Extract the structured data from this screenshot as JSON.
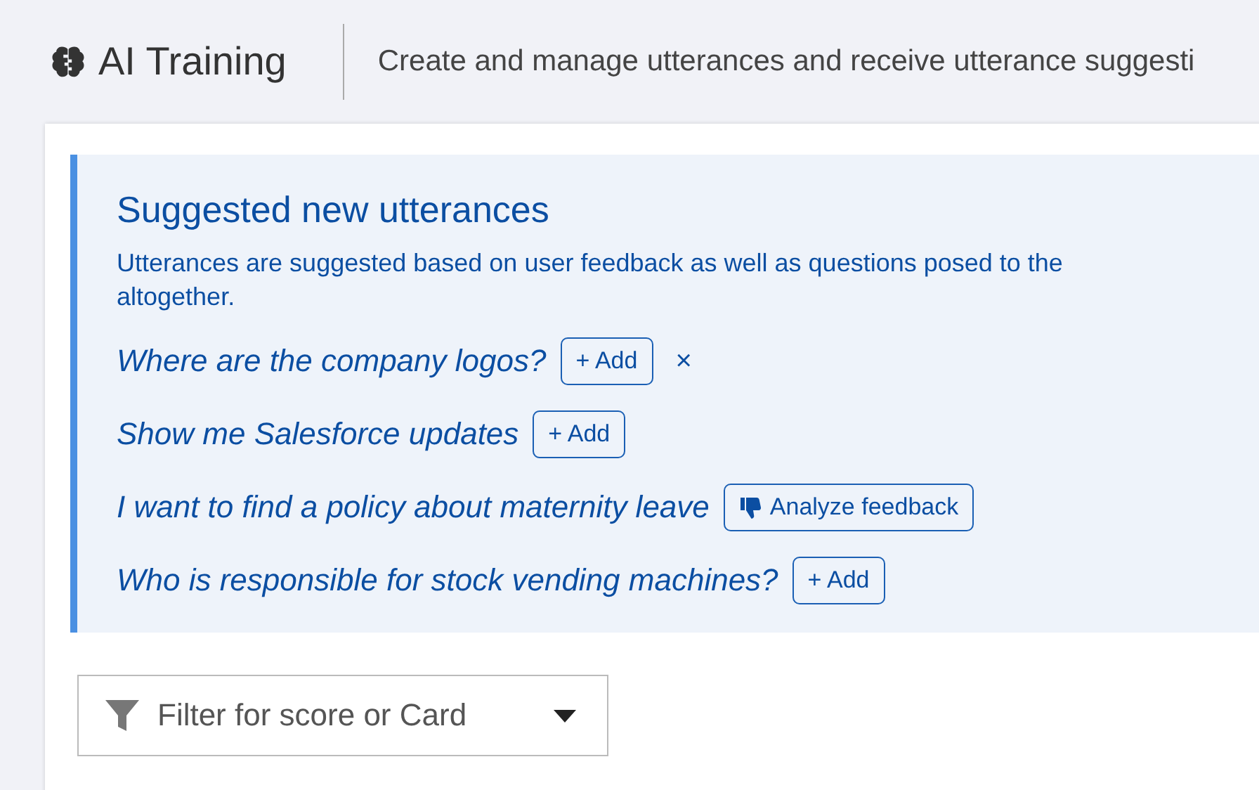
{
  "header": {
    "title": "AI Training",
    "subtitle": "Create and manage utterances and receive utterance suggesti"
  },
  "suggestions": {
    "title": "Suggested new utterances",
    "description_lines": [
      "Utterances are suggested based on user feedback as well as questions posed to the",
      "altogether."
    ],
    "items": [
      {
        "text": "Where are the company logos?",
        "kind": "add",
        "button": "+ Add",
        "dismiss": "×"
      },
      {
        "text": "Show me Salesforce updates",
        "kind": "add",
        "button": "+ Add"
      },
      {
        "text": "I want to find a policy about maternity leave",
        "kind": "feedback",
        "button": "Analyze feedback"
      },
      {
        "text": "Who is responsible for stock vending machines?",
        "kind": "add",
        "button": "+ Add"
      }
    ]
  },
  "filter": {
    "placeholder": "Filter for score or Card"
  }
}
